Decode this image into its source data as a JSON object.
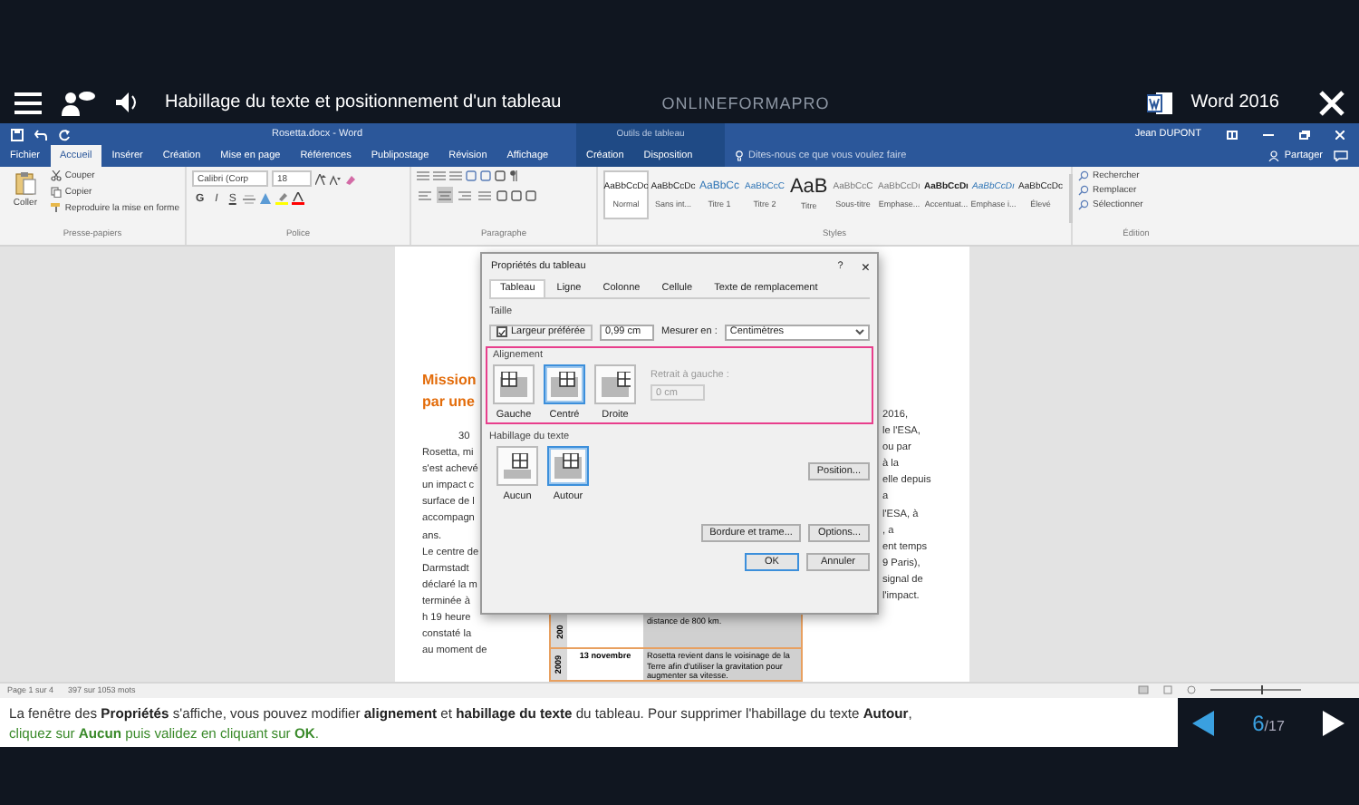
{
  "top_bar": {
    "title": "Habillage du texte et positionnement d'un tableau",
    "brand": "ONLINEFORMAPRO",
    "app": "Word 2016"
  },
  "word": {
    "document_title": "Rosetta.docx - Word",
    "context_label": "Outils de tableau",
    "user": "Jean DUPONT",
    "tabs": [
      {
        "label": "Fichier",
        "selected": false
      },
      {
        "label": "Accueil",
        "selected": true
      },
      {
        "label": "Insérer",
        "selected": false
      },
      {
        "label": "Création",
        "selected": false
      },
      {
        "label": "Mise en page",
        "selected": false
      },
      {
        "label": "Références",
        "selected": false
      },
      {
        "label": "Publipostage",
        "selected": false
      },
      {
        "label": "Révision",
        "selected": false
      },
      {
        "label": "Affichage",
        "selected": false
      }
    ],
    "context_tabs": [
      {
        "label": "Création",
        "selected": false
      },
      {
        "label": "Disposition",
        "selected": false
      }
    ],
    "search": {
      "placeholder": "Dites-nous ce que vous voulez faire"
    },
    "share": "Partager"
  },
  "ribbon": {
    "clipboard": {
      "paste": "Coller",
      "items": [
        "Couper",
        "Copier",
        "Reproduire la mise en forme"
      ],
      "label": "Presse-papiers"
    },
    "font": {
      "name": "Calibri (Corp",
      "size": "18",
      "format_buttons": [
        "G",
        "I",
        "S"
      ],
      "label": "Police"
    },
    "paragraph": {
      "alignment_buttons": [
        {
          "selected": false
        },
        {
          "selected": true
        },
        {
          "selected": false
        },
        {
          "selected": false
        }
      ],
      "label": "Paragraphe"
    },
    "styles": {
      "items": [
        {
          "preview": "AaBbCcDc",
          "name": "Normal",
          "kind": "body",
          "selected": true
        },
        {
          "preview": "AaBbCcDc",
          "name": "Sans int...",
          "kind": "body",
          "selected": false
        },
        {
          "preview": "AaBbCc",
          "name": "Titre 1",
          "kind": "heading",
          "selected": false
        },
        {
          "preview": "AaBbCcC",
          "name": "Titre 2",
          "kind": "subheading",
          "selected": false
        },
        {
          "preview": "AaB",
          "name": "Titre",
          "kind": "title",
          "selected": false
        },
        {
          "preview": "AaBbCcC",
          "name": "Sous-titre",
          "kind": "subtle",
          "selected": false
        },
        {
          "preview": "AaBbCcDı",
          "name": "Emphase...",
          "kind": "subtle",
          "selected": false
        },
        {
          "preview": "AaBbCcDı",
          "name": "Accentuat...",
          "kind": "strong",
          "selected": false
        },
        {
          "preview": "AaBbCcDı",
          "name": "Emphase i...",
          "kind": "accent",
          "selected": false
        },
        {
          "preview": "AaBbCcDc",
          "name": "Élevé",
          "kind": "body",
          "selected": false
        }
      ],
      "label": "Styles"
    },
    "editing": {
      "items": [
        "Rechercher",
        "Remplacer",
        "Sélectionner"
      ],
      "label": "Édition"
    }
  },
  "document": {
    "heading": [
      "Mission",
      "par une"
    ],
    "left_lines": [
      "30",
      "Rosetta, mi",
      "s'est achevé",
      "un impact c",
      "surface de l",
      "accompagn",
      "ans.",
      "Le centre de",
      "Darmstadt",
      "déclaré la m",
      "terminée à",
      "h 19 heure",
      "constaté la",
      "au moment de"
    ],
    "right_lines": [
      "2016,",
      "le l'ESA,",
      "ou par",
      "à la",
      "elle depuis",
      "a",
      "l'ESA, à",
      ", a",
      "ent temps",
      "9 Paris),",
      "signal de",
      "l'impact."
    ],
    "table": {
      "rows": [
        {
          "year": "200",
          "event": "distance de 800 km."
        },
        {
          "year": "2009",
          "date": "13 novembre",
          "event": "Rosetta revient dans le voisinage de la Terre afin d'utiliser la gravitation pour augmenter sa vitesse."
        }
      ]
    }
  },
  "dialog": {
    "title": "Propriétés du tableau",
    "help": "?",
    "close": "×",
    "tabs": [
      {
        "label": "Tableau",
        "selected": true
      },
      {
        "label": "Ligne",
        "selected": false
      },
      {
        "label": "Colonne",
        "selected": false
      },
      {
        "label": "Cellule",
        "selected": false
      },
      {
        "label": "Texte de remplacement",
        "selected": false
      }
    ],
    "size": {
      "label": "Taille",
      "checkbox": {
        "label": "Largeur préférée",
        "checked": true
      },
      "width": "0,99 cm",
      "measure_label": "Mesurer en :",
      "measure": "Centimètres"
    },
    "alignment": {
      "label": "Alignement",
      "options": [
        {
          "label": "Gauche",
          "kind": "left",
          "selected": false
        },
        {
          "label": "Centré",
          "kind": "center",
          "selected": true
        },
        {
          "label": "Droite",
          "kind": "right",
          "selected": false
        }
      ],
      "indent": {
        "label": "Retrait à gauche :",
        "value": "0 cm",
        "disabled": true
      }
    },
    "wrapping": {
      "label": "Habillage du texte",
      "options": [
        {
          "label": "Aucun",
          "kind": "none",
          "selected": false
        },
        {
          "label": "Autour",
          "kind": "around",
          "selected": true
        }
      ]
    },
    "buttons": {
      "position": "Position...",
      "borders": "Bordure et trame...",
      "options": "Options...",
      "ok": "OK",
      "cancel": "Annuler"
    }
  },
  "status_bar": {
    "page": "Page 1 sur 4",
    "words": "397 sur 1053 mots",
    "zoom": {
      "level": 0.55
    }
  },
  "caption": {
    "lines": [
      "La fenêtre des **Propriétés** s'affiche, vous pouvez modifier **alignement** et **habillage du texte** du tableau. Pour supprimer l'habillage du texte **Autour**,",
      "cliquez sur **Aucun** puis validez en cliquant sur **OK**."
    ]
  },
  "nav": {
    "current": "6",
    "total": "/17"
  }
}
